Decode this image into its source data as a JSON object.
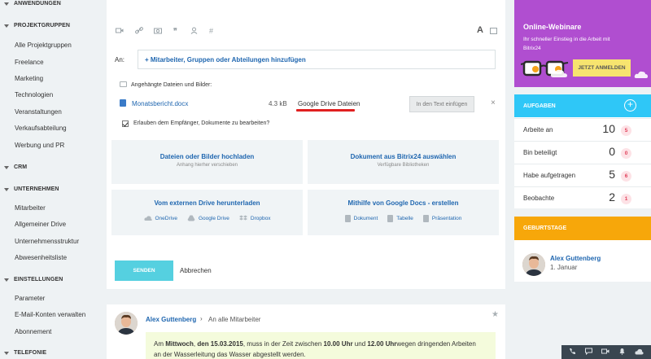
{
  "sidebar": {
    "sections": [
      {
        "label": "ANWENDUNGEN"
      },
      {
        "label": "PROJEKTGRUPPEN"
      },
      {
        "label": "CRM"
      },
      {
        "label": "UNTERNEHMEN"
      },
      {
        "label": "EINSTELLUNGEN"
      },
      {
        "label": "TELEFONIE"
      }
    ],
    "projektgruppen": [
      "Alle Projektgruppen",
      "Freelance",
      "Marketing",
      "Technologien",
      "Veranstaltungen",
      "Verkaufsabteilung",
      "Werbung und PR"
    ],
    "unternehmen": [
      "Mitarbeiter",
      "Allgemeiner Drive",
      "Unternehmensstruktur",
      "Abwesenheitsliste"
    ],
    "einstellungen": [
      "Parameter",
      "E-Mail-Konten verwalten",
      "Abonnement"
    ]
  },
  "composer": {
    "toolbar_icons": [
      "video-icon",
      "link-icon",
      "camera-icon",
      "quote-icon",
      "user-icon",
      "hashtag-icon"
    ],
    "format_letter": "A",
    "to_label": "An:",
    "add_recipients": "+ Mitarbeiter, Gruppen oder Abteilungen hinzufügen",
    "attached_title": "Angehängte Dateien und Bilder:",
    "file": {
      "name": "Monatsbericht.docx",
      "size": "4.3 kB",
      "storage": "Google Drive Dateien",
      "insert_label": "In den Text einfügen",
      "remove": "×"
    },
    "allow_edit_label": "Erlauben dem Empfänger, Dokumente zu bearbeiten?",
    "tiles": {
      "upload_title": "Dateien oder Bilder hochladen",
      "upload_sub": "Anhang hierher verschieben",
      "b24_title": "Dokument aus Bitrix24 auswählen",
      "b24_sub": "Verfügbare Bibliotheken",
      "ext_title": "Vom externen Drive herunterladen",
      "ext_opts": [
        "OneDrive",
        "Google Drive",
        "Dropbox"
      ],
      "gdocs_title": "Mithilfe von Google Docs - erstellen",
      "gdocs_opts": [
        "Dokument",
        "Tabelle",
        "Präsentation"
      ]
    },
    "send_label": "SENDEN",
    "cancel_label": "Abbrechen"
  },
  "post": {
    "author": "Alex Guttenberg",
    "arrow": "›",
    "target": "An alle Mitarbeiter",
    "star": "★",
    "msg_1": "Am ",
    "msg_day": "Mittwoch",
    "msg_2": ", ",
    "msg_date": "den 15.03.2015",
    "msg_3": ", muss in der Zeit zwischen ",
    "msg_from": "10.00 Uhr",
    "msg_4": " und ",
    "msg_to": "12.00 Uhr",
    "msg_5": "wegen dringenden Arbeiten",
    "msg_line2": "an der Wasserleitung das Wasser abgestellt werden."
  },
  "webinar": {
    "title": "Online-Webinare",
    "subtitle": "Ihr schneller Einstieg in die Arbeit mit Bitrix24",
    "button": "JETZT ANMELDEN",
    "bg_color": "#b04ed0"
  },
  "tasks": {
    "title": "AUFGABEN",
    "plus": "+",
    "rows": [
      {
        "label": "Arbeite an",
        "count": "10",
        "badge": "5"
      },
      {
        "label": "Bin beteiligt",
        "count": "0",
        "badge": "0"
      },
      {
        "label": "Habe aufgetragen",
        "count": "5",
        "badge": "6"
      },
      {
        "label": "Beobachte",
        "count": "2",
        "badge": "1"
      }
    ],
    "head_color": "#2fc7f7"
  },
  "birthdays": {
    "title": "GEBURTSTAGE",
    "name": "Alex Guttenberg",
    "date": "1. Januar",
    "head_color": "#f7a70a"
  },
  "bottom_bar": {
    "icons": [
      "phone-icon",
      "chat-icon",
      "video-icon",
      "bell-icon",
      "cloud-icon"
    ]
  }
}
